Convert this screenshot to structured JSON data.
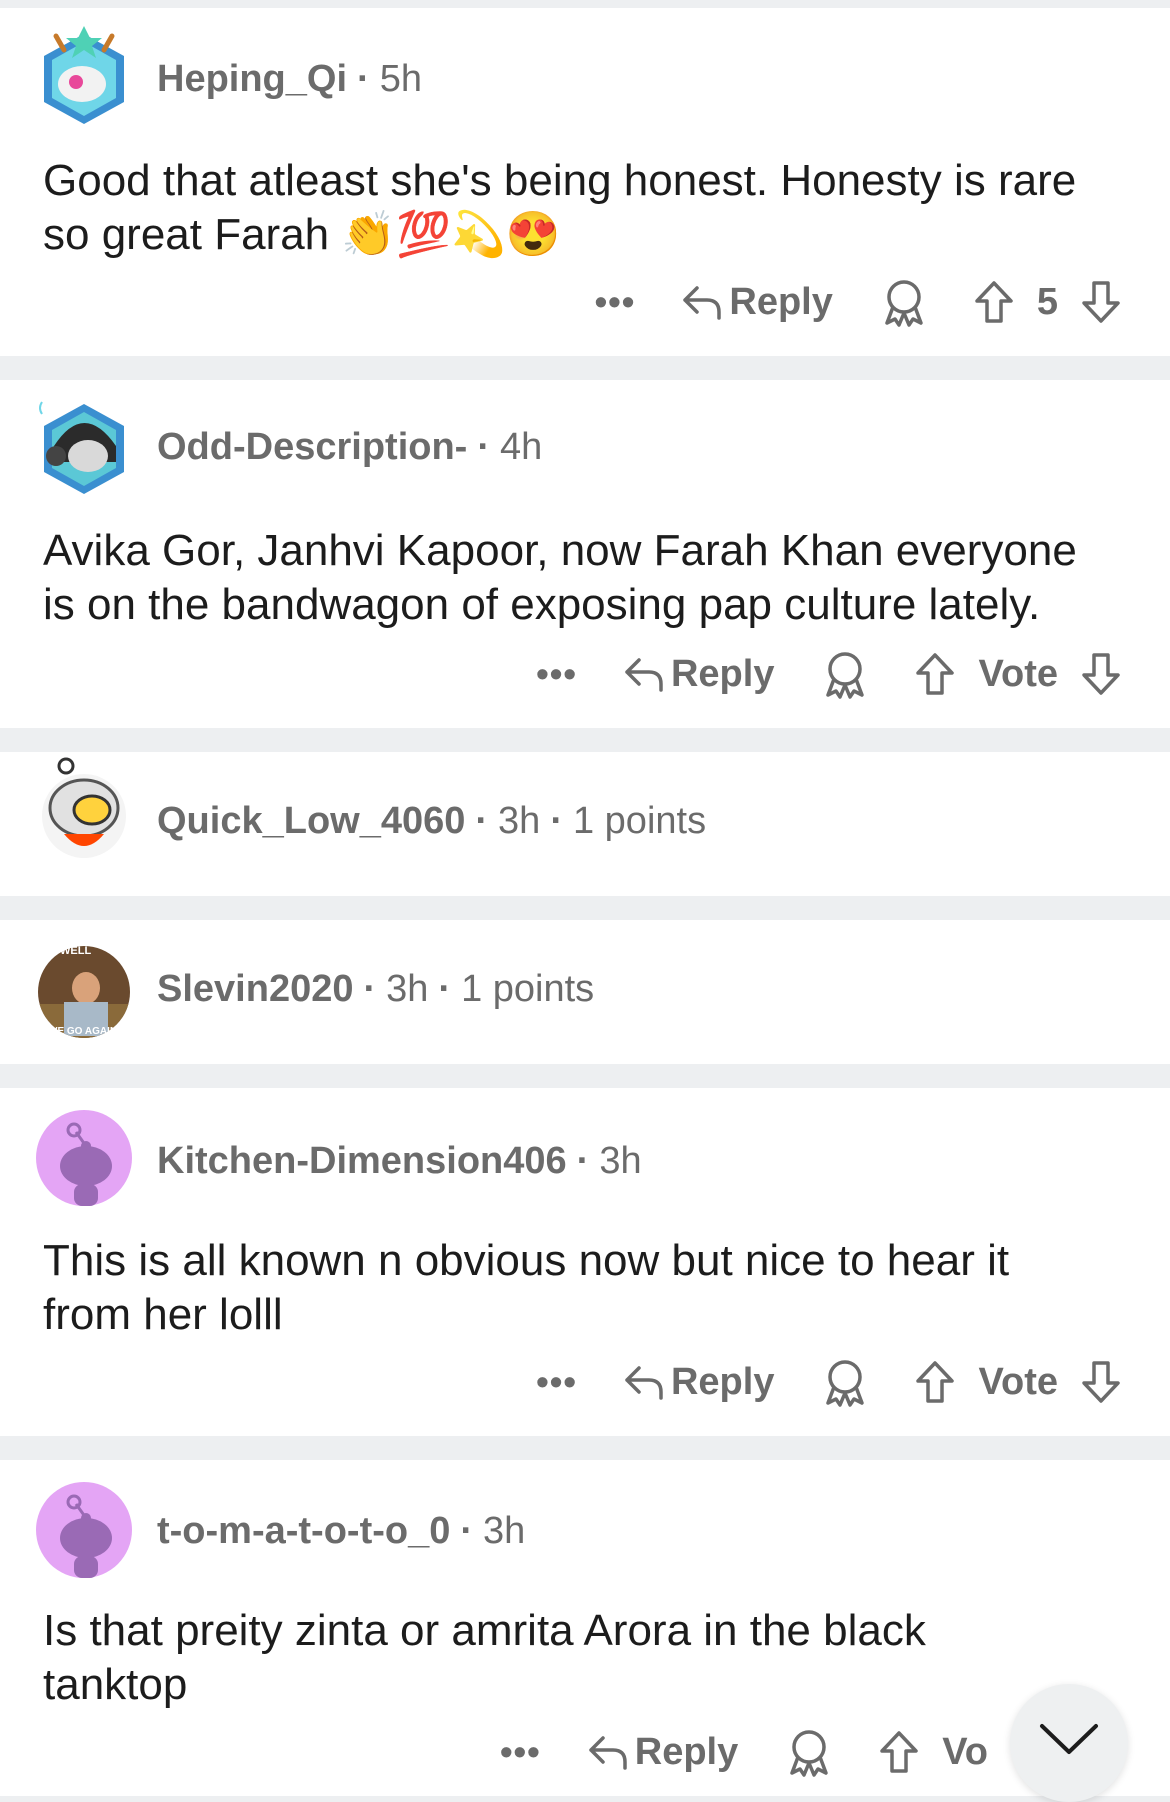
{
  "comments": [
    {
      "user": "Heping_Qi",
      "time": "5h",
      "text": "Good that atleast she's being honest. Honesty is rare so great Farah",
      "emojis": "👏💯💫😍",
      "reply_label": "Reply",
      "vote_label": "5"
    },
    {
      "user": "Odd-Description-",
      "time": "4h",
      "text": "Avika Gor, Janhvi Kapoor, now Farah Khan everyone is on the bandwagon of exposing pap culture lately.",
      "reply_label": "Reply",
      "vote_label": "Vote"
    },
    {
      "user": "Quick_Low_4060",
      "time": "3h",
      "points": "1 points"
    },
    {
      "user": "Slevin2020",
      "time": "3h",
      "points": "1 points",
      "avatar_text_top": "WELL",
      "avatar_text_bottom": "WE GO AGAIN"
    },
    {
      "user": "Kitchen-Dimension406",
      "time": "3h",
      "text": "This is all known n obvious now but nice to hear it from her lolll",
      "reply_label": "Reply",
      "vote_label": "Vote"
    },
    {
      "user": "t-o-m-a-t-o-t-o_0",
      "time": "3h",
      "text": "Is that preity zinta or amrita Arora in the black tanktop",
      "reply_label": "Reply",
      "vote_label": "Vo"
    }
  ],
  "icons": {
    "more": "more-options-icon",
    "reply": "reply-arrow-icon",
    "award": "award-icon",
    "upvote": "upvote-arrow-icon",
    "downvote": "downvote-arrow-icon",
    "scroll": "chevron-down-icon"
  },
  "colors": {
    "background": "#edeff1",
    "card": "#ffffff",
    "meta_text": "#6b6b6b",
    "body_text": "#1c1c1c",
    "snoo_avatar_bg": "#e4a5f5"
  }
}
